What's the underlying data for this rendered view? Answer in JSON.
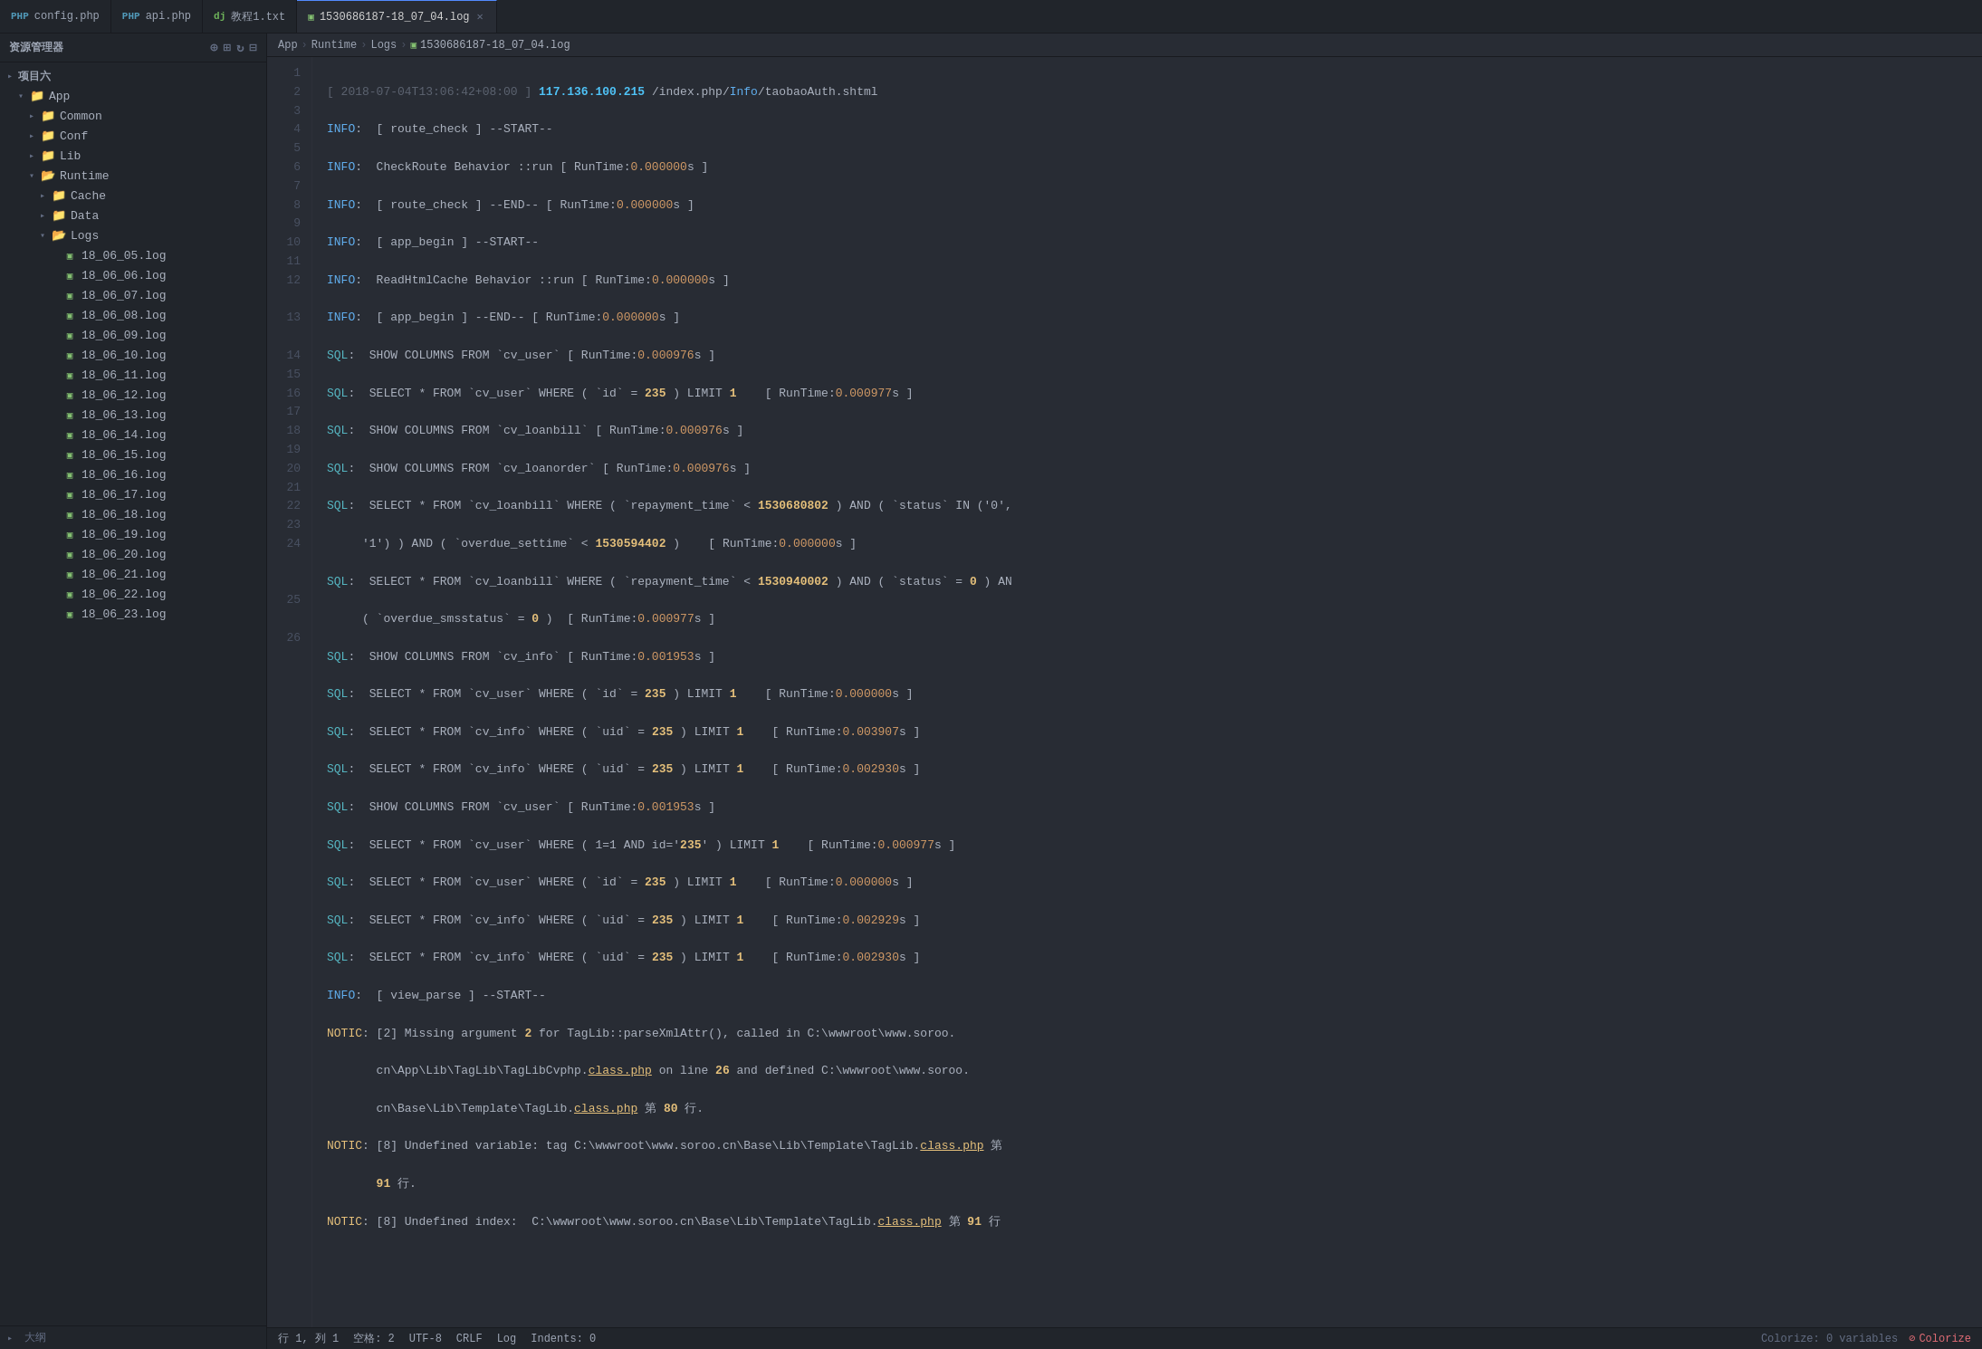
{
  "tabbar": {
    "tabs": [
      {
        "id": "config",
        "label": "config.php",
        "icon": "php",
        "icon_text": "PHP",
        "active": false,
        "closable": false
      },
      {
        "id": "api",
        "label": "api.php",
        "icon": "php",
        "icon_text": "PHP",
        "active": false,
        "closable": false
      },
      {
        "id": "jiaocheng",
        "label": "教程1.txt",
        "icon": "dj",
        "icon_text": "dj",
        "active": false,
        "closable": false
      },
      {
        "id": "log",
        "label": "1530686187-18_07_04.log",
        "icon": "log",
        "icon_text": "log",
        "active": true,
        "closable": true
      }
    ]
  },
  "sidebar": {
    "title": "资源管理器",
    "project_label": "项目六",
    "tree": [
      {
        "id": "app",
        "label": "App",
        "level": 0,
        "expanded": true,
        "type": "folder",
        "icon": "folder"
      },
      {
        "id": "common",
        "label": "Common",
        "level": 1,
        "expanded": false,
        "type": "folder",
        "icon": "folder-common"
      },
      {
        "id": "conf",
        "label": "Conf",
        "level": 1,
        "expanded": false,
        "type": "folder",
        "icon": "folder-conf"
      },
      {
        "id": "lib",
        "label": "Lib",
        "level": 1,
        "expanded": false,
        "type": "folder",
        "icon": "folder-lib"
      },
      {
        "id": "runtime",
        "label": "Runtime",
        "level": 1,
        "expanded": true,
        "type": "folder",
        "icon": "folder-runtime"
      },
      {
        "id": "cache",
        "label": "Cache",
        "level": 2,
        "expanded": false,
        "type": "folder",
        "icon": "folder-cache"
      },
      {
        "id": "data",
        "label": "Data",
        "level": 2,
        "expanded": false,
        "type": "folder",
        "icon": "folder-data"
      },
      {
        "id": "logs",
        "label": "Logs",
        "level": 2,
        "expanded": true,
        "type": "folder",
        "icon": "folder-logs"
      },
      {
        "id": "log1",
        "label": "18_06_05.log",
        "level": 3,
        "type": "file",
        "icon": "log"
      },
      {
        "id": "log2",
        "label": "18_06_06.log",
        "level": 3,
        "type": "file",
        "icon": "log"
      },
      {
        "id": "log3",
        "label": "18_06_07.log",
        "level": 3,
        "type": "file",
        "icon": "log"
      },
      {
        "id": "log4",
        "label": "18_06_08.log",
        "level": 3,
        "type": "file",
        "icon": "log"
      },
      {
        "id": "log5",
        "label": "18_06_09.log",
        "level": 3,
        "type": "file",
        "icon": "log"
      },
      {
        "id": "log6",
        "label": "18_06_10.log",
        "level": 3,
        "type": "file",
        "icon": "log"
      },
      {
        "id": "log7",
        "label": "18_06_11.log",
        "level": 3,
        "type": "file",
        "icon": "log"
      },
      {
        "id": "log8",
        "label": "18_06_12.log",
        "level": 3,
        "type": "file",
        "icon": "log"
      },
      {
        "id": "log9",
        "label": "18_06_13.log",
        "level": 3,
        "type": "file",
        "icon": "log"
      },
      {
        "id": "log10",
        "label": "18_06_14.log",
        "level": 3,
        "type": "file",
        "icon": "log"
      },
      {
        "id": "log11",
        "label": "18_06_15.log",
        "level": 3,
        "type": "file",
        "icon": "log"
      },
      {
        "id": "log12",
        "label": "18_06_16.log",
        "level": 3,
        "type": "file",
        "icon": "log"
      },
      {
        "id": "log13",
        "label": "18_06_17.log",
        "level": 3,
        "type": "file",
        "icon": "log"
      },
      {
        "id": "log14",
        "label": "18_06_18.log",
        "level": 3,
        "type": "file",
        "icon": "log"
      },
      {
        "id": "log15",
        "label": "18_06_19.log",
        "level": 3,
        "type": "file",
        "icon": "log"
      },
      {
        "id": "log16",
        "label": "18_06_20.log",
        "level": 3,
        "type": "file",
        "icon": "log"
      },
      {
        "id": "log17",
        "label": "18_06_21.log",
        "level": 3,
        "type": "file",
        "icon": "log"
      },
      {
        "id": "log18",
        "label": "18_06_22.log",
        "level": 3,
        "type": "file",
        "icon": "log"
      },
      {
        "id": "log19",
        "label": "18_06_23.log",
        "level": 3,
        "type": "file",
        "icon": "log"
      }
    ],
    "footer": "大纲"
  },
  "breadcrumb": {
    "items": [
      "App",
      "Runtime",
      "Logs",
      "1530686187-18_07_04.log"
    ]
  },
  "statusbar": {
    "position": "行 1, 列 1",
    "spaces": "空格: 2",
    "encoding": "UTF-8",
    "line_endings": "CRLF",
    "file_type": "Log",
    "indents": "Indents: 0",
    "colorize_label": "Colorize: 0 variables",
    "colorize_action": "Colorize"
  }
}
